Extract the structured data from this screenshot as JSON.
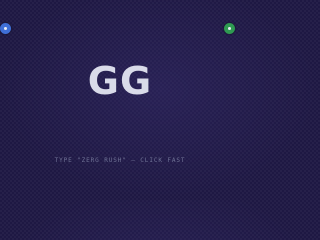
{
  "logo": {
    "text": "GG"
  },
  "hint": {
    "text": "TYPE \"ZERG RUSH\" — CLICK FAST"
  },
  "tokens": [
    {
      "name": "blue",
      "color": "#3f6fd6"
    },
    {
      "name": "green",
      "color": "#2f9a52"
    }
  ]
}
